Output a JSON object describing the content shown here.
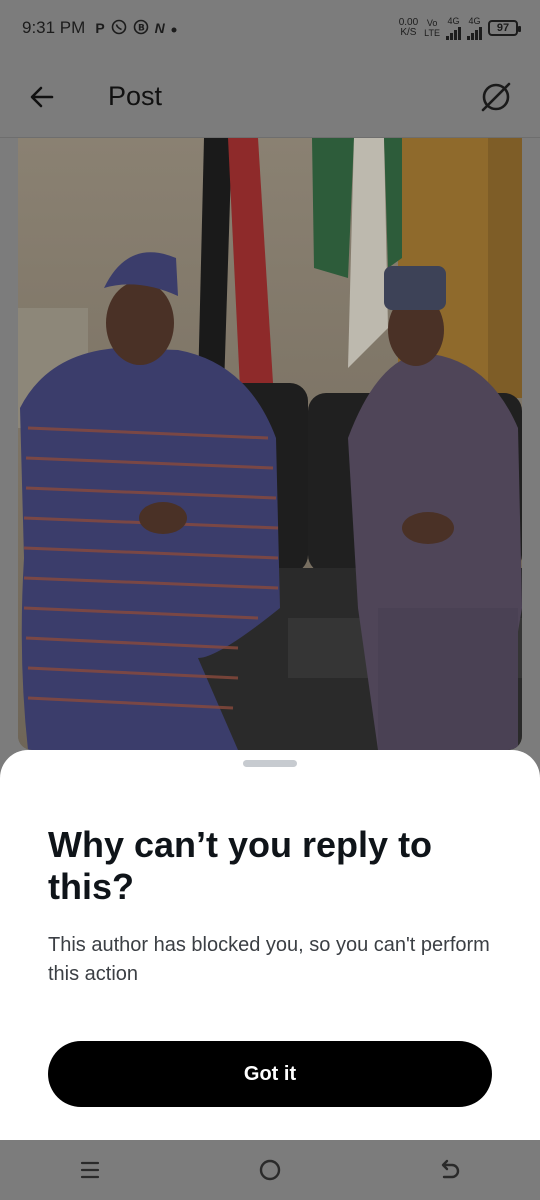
{
  "status_bar": {
    "time": "9:31 PM",
    "notification_icons": [
      "p-icon",
      "whatsapp-icon",
      "whatsapp-business-icon",
      "n-icon",
      "dot-icon"
    ],
    "notif_p": "P",
    "notif_n": "N",
    "speed_value": "0.00",
    "speed_unit": "K/S",
    "volte_top": "Vo",
    "volte_bottom": "LTE",
    "net1": "4G",
    "net2": "4G",
    "battery": "97"
  },
  "header": {
    "title": "Post"
  },
  "sheet": {
    "title": "Why can’t you reply to this?",
    "description": "This author has blocked you, so you can't perform this action",
    "button_label": "Got it"
  },
  "colors": {
    "overlay_gray": "#7c7c7c",
    "sheet_bg": "#ffffff",
    "button_bg": "#000000",
    "handle": "#c7cbd0"
  }
}
